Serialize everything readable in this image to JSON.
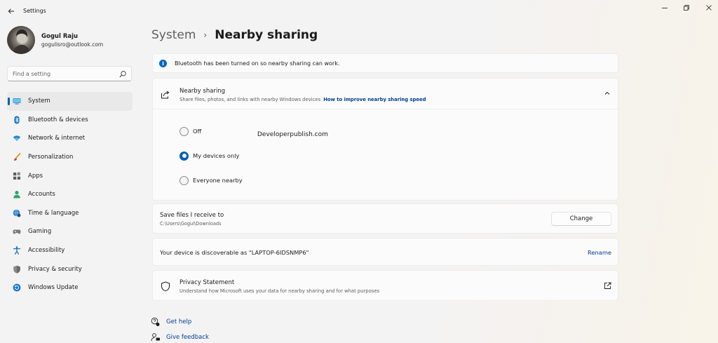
{
  "window": {
    "title": "Settings",
    "icons": {
      "back": "back-arrow-icon",
      "minimize": "minimize-icon",
      "maximize": "restore-icon",
      "close": "close-icon"
    }
  },
  "profile": {
    "name": "Gogul Raju",
    "email": "gogulisro@outlook.com"
  },
  "search": {
    "placeholder": "Find a setting",
    "value": ""
  },
  "sidebar": {
    "items": [
      {
        "label": "System",
        "icon": "monitor-icon",
        "active": true
      },
      {
        "label": "Bluetooth & devices",
        "icon": "bluetooth-icon",
        "active": false
      },
      {
        "label": "Network & internet",
        "icon": "wifi-icon",
        "active": false
      },
      {
        "label": "Personalization",
        "icon": "brush-icon",
        "active": false
      },
      {
        "label": "Apps",
        "icon": "apps-grid-icon",
        "active": false
      },
      {
        "label": "Accounts",
        "icon": "person-icon",
        "active": false
      },
      {
        "label": "Time & language",
        "icon": "globe-clock-icon",
        "active": false
      },
      {
        "label": "Gaming",
        "icon": "gamepad-icon",
        "active": false
      },
      {
        "label": "Accessibility",
        "icon": "accessibility-icon",
        "active": false
      },
      {
        "label": "Privacy & security",
        "icon": "shield-icon",
        "active": false
      },
      {
        "label": "Windows Update",
        "icon": "update-icon",
        "active": false
      }
    ]
  },
  "header": {
    "parent": "System",
    "separator": "›",
    "current": "Nearby sharing"
  },
  "info_bar": {
    "icon_letter": "i",
    "text": "Bluetooth has been turned on so nearby sharing can work."
  },
  "nearby_sharing": {
    "title": "Nearby sharing",
    "description": "Share files, photos, and links with nearby Windows devices",
    "link": "How to improve nearby sharing speed",
    "expanded": true,
    "options": [
      {
        "label": "Off",
        "checked": false
      },
      {
        "label": "My devices only",
        "checked": true
      },
      {
        "label": "Everyone nearby",
        "checked": false
      }
    ],
    "overlay_text": "Developerpublish.com"
  },
  "save_files": {
    "title": "Save files I receive to",
    "path": "C:\\Users\\Gogul\\Downloads",
    "button": "Change"
  },
  "discoverable": {
    "text": "Your device is discoverable as \"LAPTOP-6IDSNMP6\"",
    "link": "Rename"
  },
  "privacy": {
    "title": "Privacy Statement",
    "description": "Understand how Microsoft uses your data for nearby sharing and for what purposes"
  },
  "help": {
    "get_help": "Get help",
    "give_feedback": "Give feedback"
  },
  "colors": {
    "accent": "#005fb8",
    "link": "#003e92",
    "card": "#fbfbfb",
    "background": "#f3f3f3"
  }
}
